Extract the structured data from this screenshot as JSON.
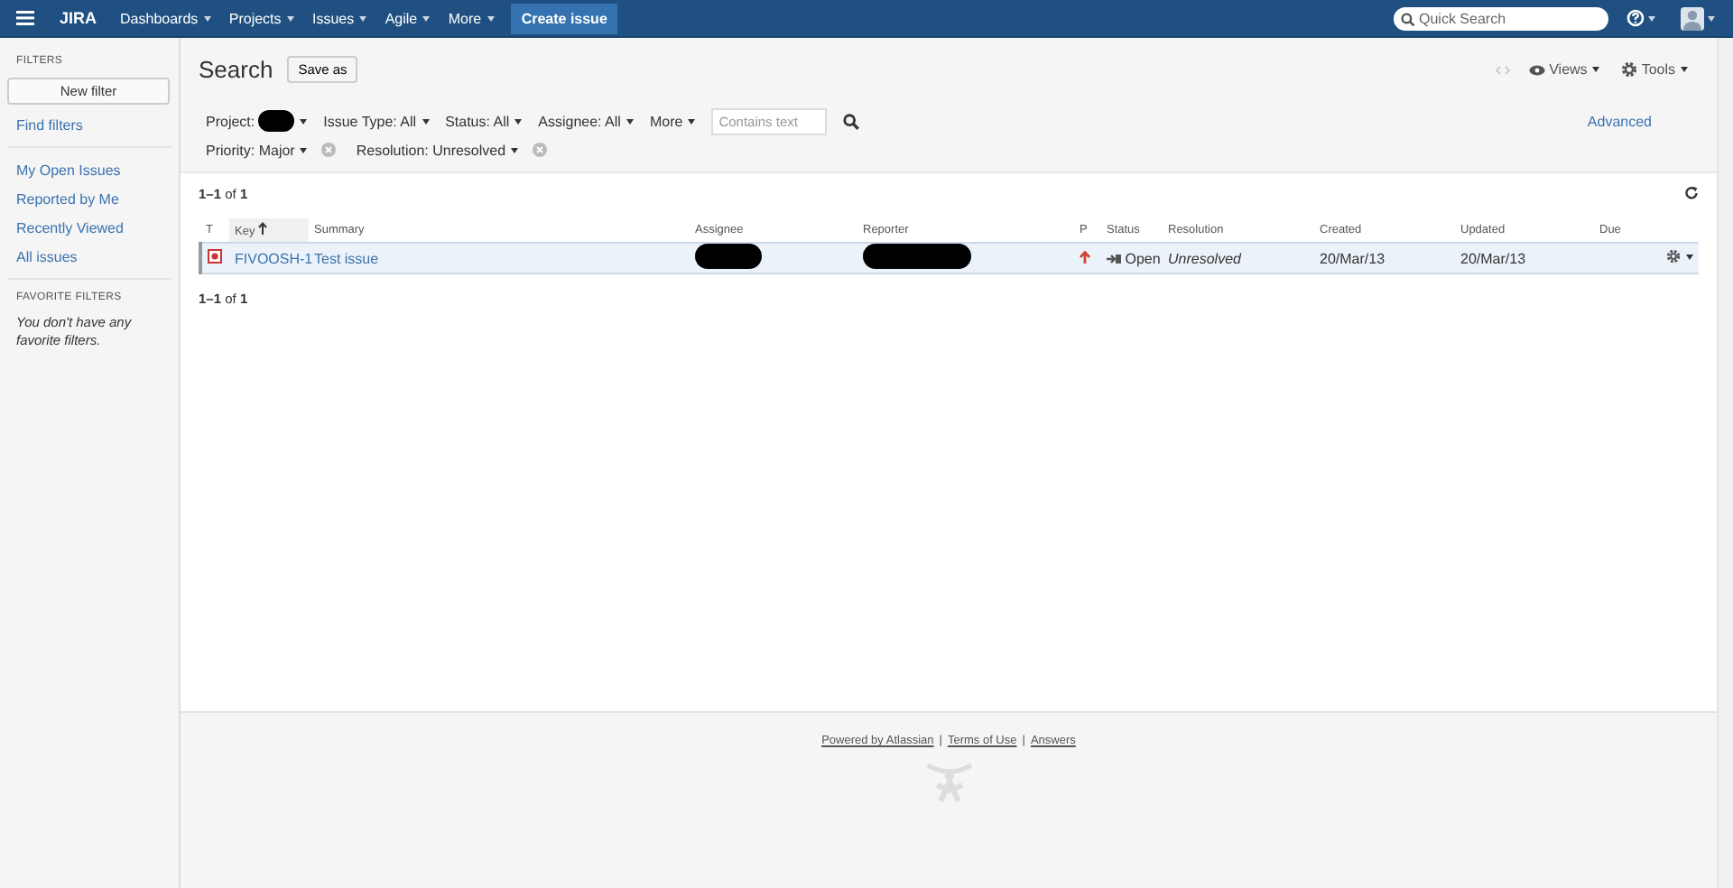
{
  "header": {
    "logo": "JIRA",
    "nav": [
      {
        "label": "Dashboards"
      },
      {
        "label": "Projects"
      },
      {
        "label": "Issues"
      },
      {
        "label": "Agile"
      },
      {
        "label": "More"
      }
    ],
    "create_button": "Create issue",
    "search": {
      "placeholder": "Quick Search"
    }
  },
  "sidebar": {
    "title": "FILTERS",
    "new_filter": "New filter",
    "find_filters": "Find filters",
    "items": [
      {
        "label": "My Open Issues"
      },
      {
        "label": "Reported by Me"
      },
      {
        "label": "Recently Viewed"
      },
      {
        "label": "All issues"
      }
    ],
    "favorites_title": "FAVORITE FILTERS",
    "favorites_empty": "You don't have any favorite filters."
  },
  "search": {
    "title": "Search",
    "save_as": "Save as",
    "views": "Views",
    "tools": "Tools",
    "advanced": "Advanced",
    "criteria": [
      {
        "kind": "redacted",
        "label": "Project:"
      },
      {
        "kind": "value",
        "label": "Issue Type:",
        "value": "All"
      },
      {
        "kind": "value",
        "label": "Status:",
        "value": "All"
      },
      {
        "kind": "value",
        "label": "Assignee:",
        "value": "All"
      },
      {
        "kind": "more",
        "label": "More"
      },
      {
        "kind": "text",
        "placeholder": "Contains text"
      }
    ],
    "extra_criteria": [
      {
        "label": "Priority:",
        "value": "Major"
      },
      {
        "label": "Resolution:",
        "value": "Unresolved"
      }
    ]
  },
  "results": {
    "count_top": "**1–1** of **1**",
    "count_bottom": "**1–1** of **1**",
    "columns": [
      "T",
      "Key",
      "Summary",
      "Assignee",
      "Reporter",
      "P",
      "Status",
      "Resolution",
      "Created",
      "Updated",
      "Due"
    ],
    "rows": [
      {
        "selected": true,
        "key": "FIVOOSH-1",
        "summary": "Test issue",
        "status": "Open",
        "resolution": "Unresolved",
        "created": "20/Mar/13",
        "updated": "20/Mar/13"
      }
    ]
  },
  "footer": [
    {
      "kind": "link",
      "text": "Powered by Atlassian"
    },
    {
      "kind": "sep",
      "text": "|"
    },
    {
      "kind": "link",
      "text": "Terms of Use"
    },
    {
      "kind": "sep",
      "text": "|"
    },
    {
      "kind": "link",
      "text": "Answers"
    }
  ]
}
